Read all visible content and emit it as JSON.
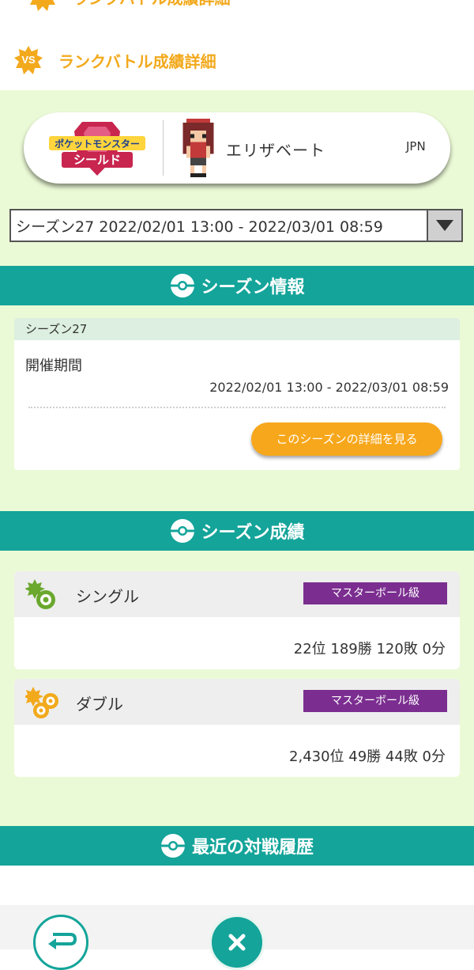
{
  "ghost_header": {
    "title": "ランクバトル成績詳細"
  },
  "header": {
    "badge_text": "VS",
    "title": "ランクバトル成績詳細"
  },
  "trainer": {
    "game_logo_line1": "ポケットモンスター",
    "game_logo_line2": "シールド",
    "name": "エリザベート",
    "region": "JPN"
  },
  "season_select": {
    "selected": "シーズン27 2022/02/01 13:00 - 2022/03/01 08:59"
  },
  "season_info": {
    "section_title": "シーズン情報",
    "season_name": "シーズン27",
    "period_label": "開催期間",
    "period_value": "2022/02/01 13:00 - 2022/03/01 08:59",
    "detail_button": "このシーズンの詳細を見る"
  },
  "season_results": {
    "section_title": "シーズン成績",
    "records": [
      {
        "name": "シングル",
        "rank_class": "マスターボール級",
        "stats": "22位 189勝 120敗 0分"
      },
      {
        "name": "ダブル",
        "rank_class": "マスターボール級",
        "stats": "2,430位 49勝 44敗 0分"
      }
    ]
  },
  "recent": {
    "section_title": "最近の対戦履歴"
  },
  "colors": {
    "teal": "#14a49a",
    "light_green": "#ebfad6",
    "orange": "#f7a71b",
    "purple": "#7b2e90",
    "title_gold": "#f2a91c"
  },
  "icons": {
    "header_badge": "vs-star-badge-icon",
    "section_ball": "pokeball-icon",
    "select_arrow": "triangle-down-icon",
    "single": "single-battle-icon",
    "double": "double-battle-icon",
    "back": "back-arrow-icon",
    "close": "close-icon"
  }
}
